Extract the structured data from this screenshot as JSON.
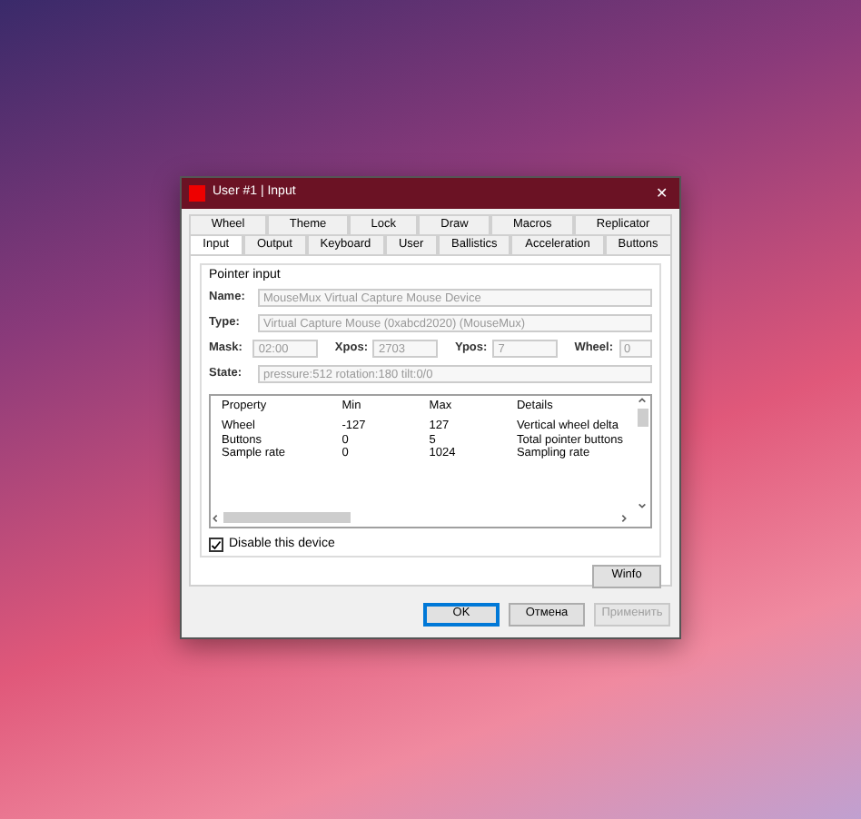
{
  "window": {
    "title": "User #1 | Input",
    "close": "✕"
  },
  "tab_rows": [
    [
      {
        "label": "Wheel",
        "selected": false
      },
      {
        "label": "Theme",
        "selected": false
      },
      {
        "label": "Lock",
        "selected": false
      },
      {
        "label": "Draw",
        "selected": false
      },
      {
        "label": "Macros",
        "selected": false
      },
      {
        "label": "Replicator",
        "selected": false
      }
    ],
    [
      {
        "label": "Input",
        "selected": true
      },
      {
        "label": "Output",
        "selected": false
      },
      {
        "label": "Keyboard",
        "selected": false
      },
      {
        "label": "User",
        "selected": false
      },
      {
        "label": "Ballistics",
        "selected": false
      },
      {
        "label": "Acceleration",
        "selected": false
      },
      {
        "label": "Buttons",
        "selected": false
      }
    ]
  ],
  "group": {
    "title": "Pointer input",
    "field_rows": [
      [
        {
          "label": "Name:",
          "value": "MouseMux Virtual Capture Mouse Device"
        }
      ],
      [
        {
          "label": "Type:",
          "value": "Virtual Capture Mouse (0xabcd2020) (MouseMux)"
        }
      ],
      [
        {
          "label": "Mask:",
          "value": "02:00"
        },
        {
          "label": "Xpos:",
          "value": "2703"
        },
        {
          "label": "Ypos:",
          "value": "7"
        },
        {
          "label": "Wheel:",
          "value": "0"
        }
      ],
      [
        {
          "label": "State:",
          "value": "pressure:512 rotation:180 tilt:0/0"
        }
      ]
    ],
    "table": {
      "columns": [
        "Property",
        "Min",
        "Max",
        "Details"
      ],
      "rows": [
        [
          "Wheel",
          "-127",
          "127",
          "Vertical wheel delta"
        ],
        [
          "Buttons",
          "0",
          "5",
          "Total pointer buttons"
        ],
        [
          "Sample rate",
          "0",
          "1024",
          "Sampling rate"
        ]
      ]
    },
    "checkbox": {
      "label": "Disable this device",
      "checked": true
    }
  },
  "winfo_button": "Winfo",
  "buttons": [
    {
      "label": "OK",
      "default": true,
      "disabled": false
    },
    {
      "label": "Отмена",
      "default": false,
      "disabled": false
    },
    {
      "label": "Применить",
      "default": false,
      "disabled": true
    }
  ]
}
